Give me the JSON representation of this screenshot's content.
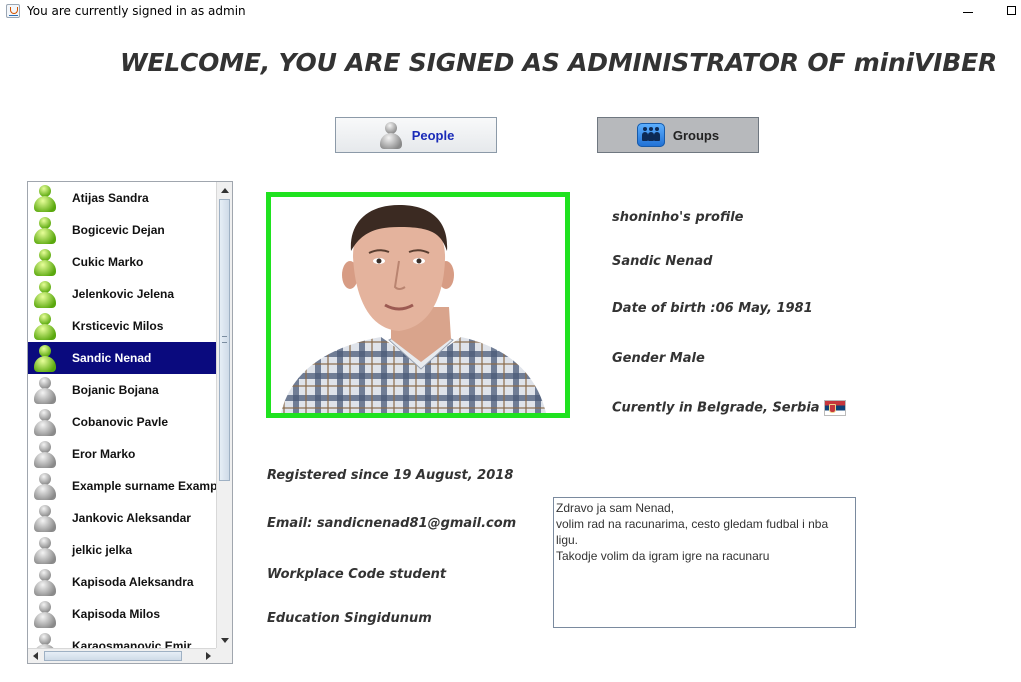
{
  "window": {
    "title": "You are currently signed in as admin"
  },
  "heading": "WELCOME, YOU ARE SIGNED AS ADMINISTRATOR OF miniVIBER",
  "tabs": {
    "people": "People",
    "groups": "Groups"
  },
  "users": [
    {
      "name": "Atijas Sandra",
      "status": "online"
    },
    {
      "name": "Bogicevic Dejan",
      "status": "online"
    },
    {
      "name": "Cukic Marko",
      "status": "online"
    },
    {
      "name": "Jelenkovic Jelena",
      "status": "online"
    },
    {
      "name": "Krsticevic Milos",
      "status": "online"
    },
    {
      "name": "Sandic Nenad",
      "status": "online",
      "selected": true
    },
    {
      "name": "Bojanic Bojana",
      "status": "offline"
    },
    {
      "name": "Cobanovic Pavle",
      "status": "offline"
    },
    {
      "name": "Eror Marko",
      "status": "offline"
    },
    {
      "name": "Example surname Example",
      "status": "offline"
    },
    {
      "name": "Jankovic Aleksandar",
      "status": "offline"
    },
    {
      "name": "jelkic jelka",
      "status": "offline"
    },
    {
      "name": "Kapisoda Aleksandra",
      "status": "offline"
    },
    {
      "name": "Kapisoda Milos",
      "status": "offline"
    },
    {
      "name": "Karaosmanovic Emir",
      "status": "offline"
    }
  ],
  "profile": {
    "username_line": "shoninho's profile",
    "full_name": "Sandic Nenad",
    "dob": "Date of birth :06 May, 1981",
    "gender": "Gender Male",
    "location": "Curently in Belgrade, Serbia",
    "registered": "Registered since 19 August, 2018",
    "email": "Email: sandicnenad81@gmail.com",
    "workplace": "Workplace Code student",
    "education": "Education Singidunum",
    "about": "Zdravo ja sam Nenad,\nvolim rad na racunarima, cesto gledam fudbal i nba\nligu.\nTakodje volim da igram igre na racunaru"
  },
  "colors": {
    "selection": "#0a0a7e",
    "photo_border": "#1fe21f",
    "people_label": "#1a2bb8"
  }
}
